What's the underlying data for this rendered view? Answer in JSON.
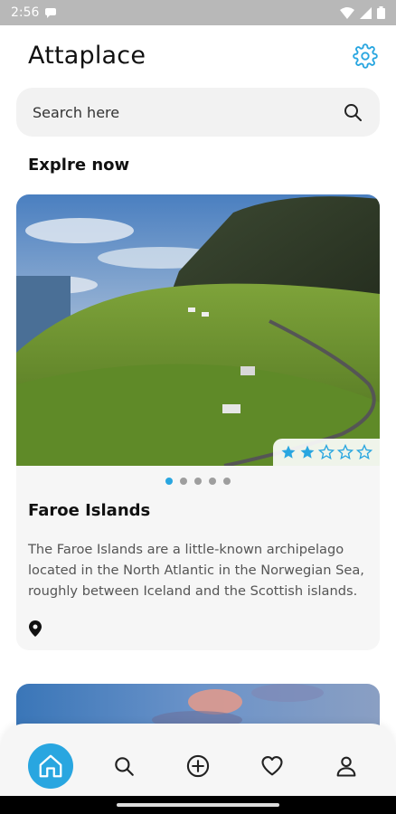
{
  "status_bar": {
    "time": "2:56"
  },
  "app": {
    "title": "Attaplace"
  },
  "search": {
    "placeholder": "Search here"
  },
  "section": {
    "title": "Explre now"
  },
  "featured_card": {
    "title": "Faroe Islands",
    "description": "The Faroe Islands are a little-known archipelago located in the North Atlantic in the Norwegian Sea, roughly between Iceland and the Scottish islands.",
    "rating": 2,
    "rating_max": 5,
    "carousel_pages": 5,
    "carousel_active": 1
  },
  "bottom_nav": {
    "items": [
      {
        "icon": "home-icon",
        "active": true
      },
      {
        "icon": "search-icon",
        "active": false
      },
      {
        "icon": "add-icon",
        "active": false
      },
      {
        "icon": "heart-icon",
        "active": false
      },
      {
        "icon": "profile-icon",
        "active": false
      }
    ]
  },
  "colors": {
    "accent": "#29a6e0",
    "star": "#29a6e0"
  }
}
